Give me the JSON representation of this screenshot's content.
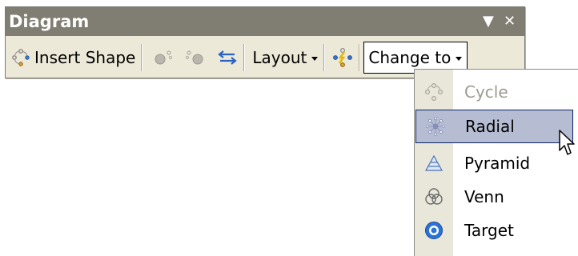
{
  "toolbar": {
    "title": "Diagram",
    "dropdown_glyph": "▼",
    "close_glyph": "✕",
    "insert_shape_label": "Insert Shape",
    "layout_label": "Layout",
    "change_to_label": "Change to",
    "icons": [
      "diagram-cycle-icon",
      "move-shape-backward-icon",
      "move-shape-forward-icon",
      "reverse-diagram-icon",
      "autoformat-icon"
    ]
  },
  "menu": {
    "items": [
      {
        "label": "Cycle",
        "icon": "cycle-icon",
        "enabled": false
      },
      {
        "label": "Radial",
        "icon": "radial-icon",
        "enabled": true,
        "highlighted": true
      },
      {
        "label": "Pyramid",
        "icon": "pyramid-icon",
        "enabled": true
      },
      {
        "label": "Venn",
        "icon": "venn-icon",
        "enabled": true
      },
      {
        "label": "Target",
        "icon": "target-icon",
        "enabled": true
      }
    ]
  },
  "colors": {
    "title_bar": "#807d72",
    "toolbar_bg": "#ece9d8",
    "menu_hover_bg": "#b6bdd2",
    "menu_hover_border": "#0a246a",
    "disabled_text": "#9d9b90"
  }
}
